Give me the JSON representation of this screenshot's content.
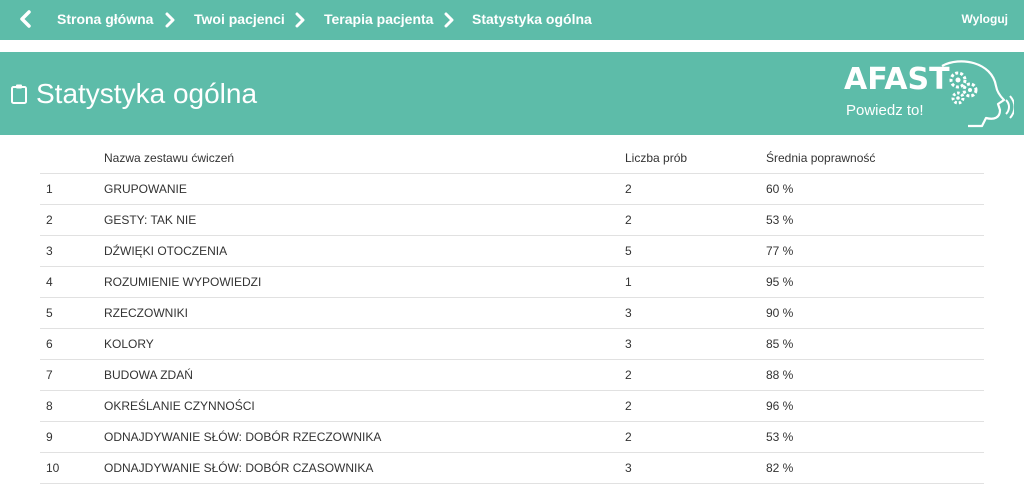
{
  "nav": {
    "back_icon": "chevron-left-icon",
    "breadcrumbs": [
      "Strona główna",
      "Twoi pacjenci",
      "Terapia pacjenta",
      "Statystyka ogólna"
    ],
    "logout": "Wyloguj"
  },
  "header": {
    "title": "Statystyka ogólna",
    "icon": "clipboard-icon",
    "logo_name": "AFAST",
    "logo_tagline": "Powiedz to!"
  },
  "colors": {
    "accent": "#5dbca9",
    "text": "#333333",
    "divider": "#e1e1e1"
  },
  "table": {
    "headers": [
      "",
      "Nazwa zestawu ćwiczeń",
      "Liczba prób",
      "Średnia poprawność"
    ],
    "rows": [
      {
        "idx": "1",
        "name": "GRUPOWANIE",
        "count": "2",
        "avg": "60 %"
      },
      {
        "idx": "2",
        "name": "GESTY: TAK NIE",
        "count": "2",
        "avg": "53 %"
      },
      {
        "idx": "3",
        "name": "DŹWIĘKI OTOCZENIA",
        "count": "5",
        "avg": "77 %"
      },
      {
        "idx": "4",
        "name": "ROZUMIENIE WYPOWIEDZI",
        "count": "1",
        "avg": "95 %"
      },
      {
        "idx": "5",
        "name": "RZECZOWNIKI",
        "count": "3",
        "avg": "90 %"
      },
      {
        "idx": "6",
        "name": "KOLORY",
        "count": "3",
        "avg": "85 %"
      },
      {
        "idx": "7",
        "name": "BUDOWA ZDAŃ",
        "count": "2",
        "avg": "88 %"
      },
      {
        "idx": "8",
        "name": "OKREŚLANIE CZYNNOŚCI",
        "count": "2",
        "avg": "96 %"
      },
      {
        "idx": "9",
        "name": "ODNAJDYWANIE SŁÓW: DOBÓR RZECZOWNIKA",
        "count": "2",
        "avg": "53 %"
      },
      {
        "idx": "10",
        "name": "ODNAJDYWANIE SŁÓW: DOBÓR CZASOWNIKA",
        "count": "3",
        "avg": "82 %"
      }
    ]
  }
}
